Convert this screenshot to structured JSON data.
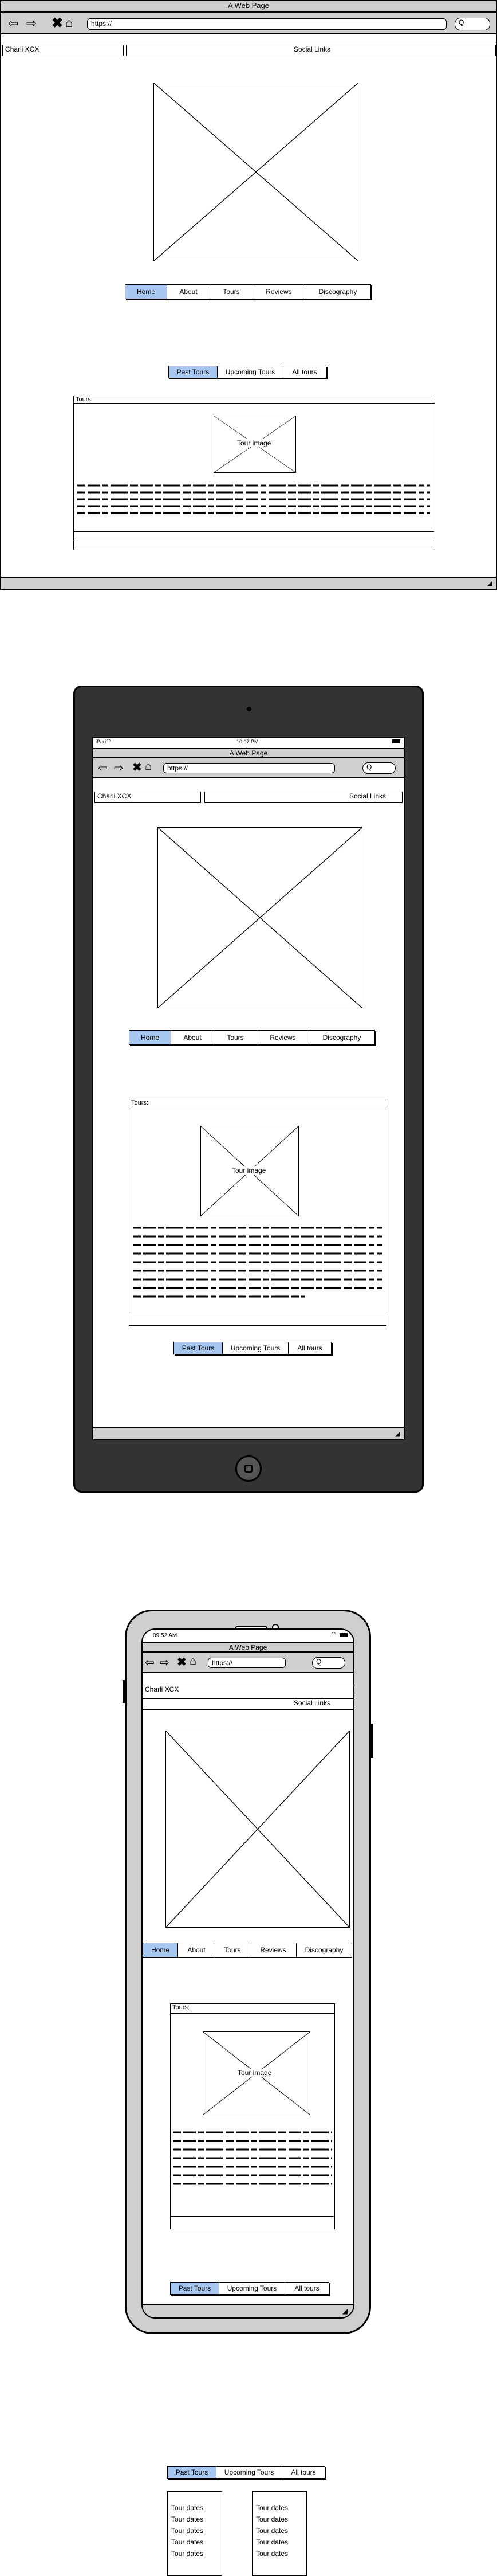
{
  "desktop": {
    "window_title": "A Web Page",
    "url": "https://",
    "search": "Q",
    "site_name": "Charli XCX",
    "social_links": "Social Links",
    "nav": [
      "Home",
      "About",
      "Tours",
      "Reviews",
      "Discography"
    ],
    "nav_selected": 0,
    "tour_tabs": [
      "Past Tours",
      "Upcoming Tours",
      "All tours"
    ],
    "tour_tabs_selected": 0,
    "tours_panel_title": "Tours",
    "tour_image_label": "Tour image"
  },
  "tablet": {
    "carrier": "iPad",
    "time": "10:07 PM",
    "window_title": "A Web Page",
    "url": "https://",
    "search": "Q",
    "site_name": "Charli XCX",
    "social_links": "Social Links",
    "nav": [
      "Home",
      "About",
      "Tours",
      "Reviews",
      "Discography"
    ],
    "nav_selected": 0,
    "tours_panel_title": "Tours:",
    "tour_image_label": "Tour image",
    "tour_tabs": [
      "Past Tours",
      "Upcoming Tours",
      "All tours"
    ],
    "tour_tabs_selected": 0
  },
  "phone": {
    "time": "09:52 AM",
    "window_title": "A Web Page",
    "url": "https://",
    "search": "Q",
    "site_name": "Charli XCX",
    "social_links": "Social Links",
    "nav": [
      "Home",
      "About",
      "Tours",
      "Reviews",
      "Discography"
    ],
    "nav_selected": 0,
    "tours_panel_title": "Tours:",
    "tour_image_label": "Tour image",
    "tour_tabs": [
      "Past Tours",
      "Upcoming Tours",
      "All tours"
    ],
    "tour_tabs_selected": 0
  },
  "bottom": {
    "tour_tabs": [
      "Past Tours",
      "Upcoming Tours",
      "All tours"
    ],
    "tour_tabs_selected": 0,
    "list_left": [
      "Tour dates",
      "Tour dates",
      "Tour dates",
      "Tour dates",
      "Tour dates"
    ],
    "list_right": [
      "Tour dates",
      "Tour dates",
      "Tour dates",
      "Tour dates",
      "Tour dates"
    ]
  },
  "colors": {
    "selected": "#a8c7f0",
    "chrome": "#cfcfcf",
    "device": "#333333"
  },
  "icons": [
    "back-arrow-icon",
    "forward-arrow-icon",
    "close-x-icon",
    "home-icon",
    "search-icon",
    "resize-grip-icon",
    "wifi-icon",
    "battery-icon",
    "camera-icon",
    "home-button-icon"
  ]
}
